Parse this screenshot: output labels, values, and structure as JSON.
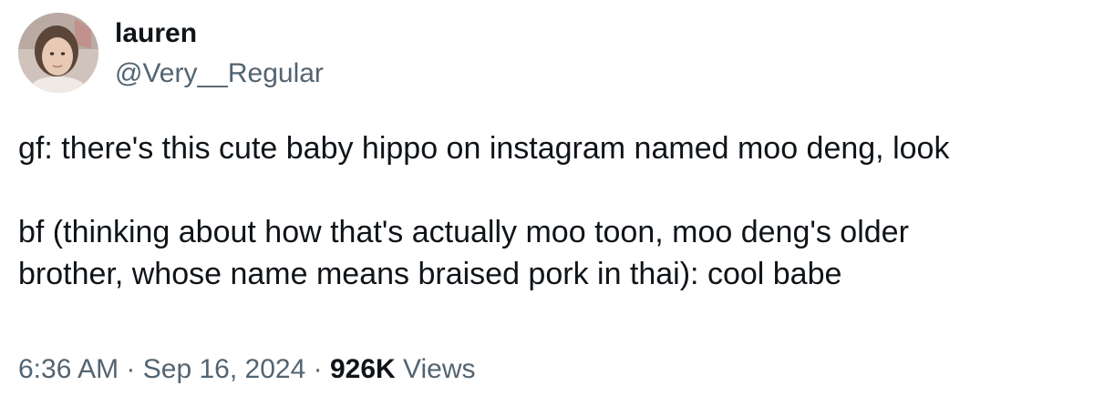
{
  "author": {
    "display_name": "lauren",
    "handle": "@Very__Regular",
    "avatar": "profile-photo"
  },
  "tweet": {
    "line_1": "gf: there's this cute baby hippo on instagram named moo deng, look",
    "line_2": "bf (thinking about how that's actually moo toon, moo deng's older",
    "line_3": "brother, whose name means braised pork in thai): cool babe"
  },
  "meta": {
    "time": "6:36 AM",
    "separator": "·",
    "date": "Sep 16, 2024",
    "views_count": "926K",
    "views_label": "Views"
  },
  "colors": {
    "primary_text": "#0f1419",
    "secondary_text": "#536471",
    "background": "#ffffff"
  }
}
